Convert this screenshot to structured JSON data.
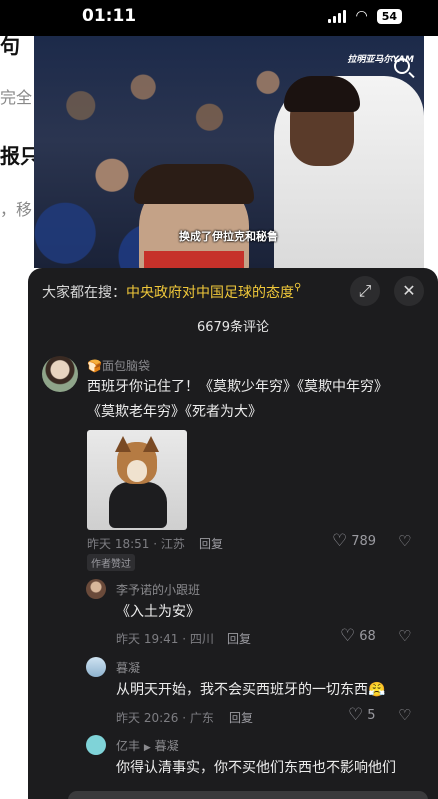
{
  "status_bar": {
    "time": "01:11",
    "battery": "54"
  },
  "background_page": {
    "lines": [
      "句",
      "完全",
      "报只",
      "，移"
    ]
  },
  "video": {
    "watermark": "拉明亚马尔YAM",
    "caption": "换成了伊拉克和秘鲁"
  },
  "panel": {
    "search_prefix": "大家都在搜：",
    "search_keyword": "中央政府对中国足球的态度",
    "comment_count": "6679条评论"
  },
  "comments": [
    {
      "username": "🍞面包脑袋",
      "text_line1": "西班牙你记住了！《莫欺少年穷》《莫欺中年穷》",
      "text_line2": "《莫欺老年穷》《死者为大》",
      "time": "昨天 18:51 · 江苏",
      "reply": "回复",
      "likes": "789",
      "tag": "作者赞过"
    },
    {
      "username": "李予诺的小跟班",
      "text": "《入土为安》",
      "time": "昨天 19:41 · 四川",
      "reply": "回复",
      "likes": "68"
    },
    {
      "username": "暮凝",
      "text": "从明天开始，我不会买西班牙的一切东西😤",
      "time": "昨天 20:26 · 广东",
      "reply": "回复",
      "likes": "5"
    },
    {
      "username": "亿丰",
      "reply_to": "暮凝",
      "text": "你得认清事实，你不买他们东西也不影响他们"
    }
  ]
}
